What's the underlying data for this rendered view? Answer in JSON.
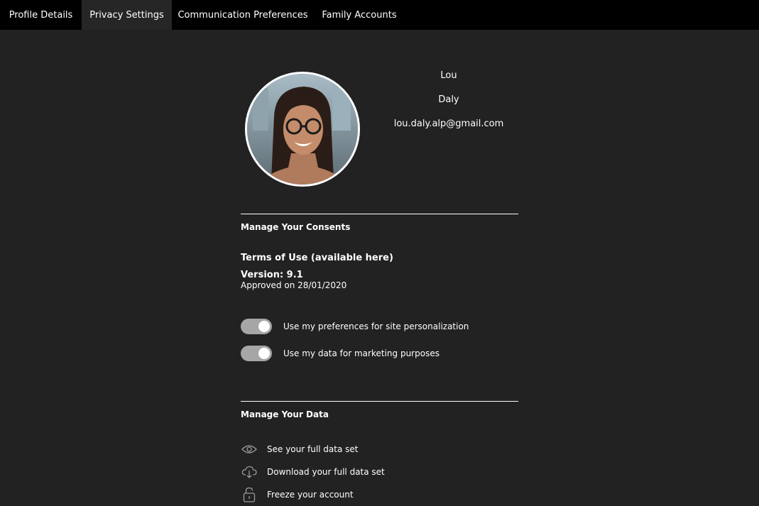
{
  "tabs": [
    {
      "label": "Profile Details",
      "active": false
    },
    {
      "label": "Privacy Settings",
      "active": true
    },
    {
      "label": "Communication Preferences",
      "active": false
    },
    {
      "label": "Family Accounts",
      "active": false
    }
  ],
  "user": {
    "first_name": "Lou",
    "last_name": "Daly",
    "email": "lou.daly.alp@gmail.com"
  },
  "consents": {
    "title": "Manage Your Consents",
    "terms_title": "Terms of Use (available here)",
    "version": "Version: 9.1",
    "approved": "Approved on 28/01/2020",
    "toggles": [
      {
        "label": "Use my preferences for site personalization",
        "on": true
      },
      {
        "label": "Use my data for marketing purposes",
        "on": true
      }
    ]
  },
  "data_section": {
    "title": "Manage Your Data",
    "items": [
      {
        "label": "See your full data set",
        "icon": "eye-icon"
      },
      {
        "label": "Download your full data set",
        "icon": "cloud-download-icon"
      },
      {
        "label": "Freeze your account",
        "icon": "lock-icon"
      }
    ]
  },
  "colors": {
    "background": "#222222",
    "tabbar": "#000000",
    "active_tab": "#262626",
    "toggle_track": "#a6a6a6"
  }
}
